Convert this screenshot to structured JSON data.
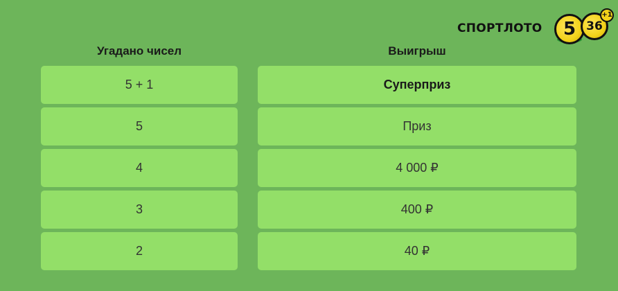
{
  "logo": {
    "text": "СПОРТЛОТО",
    "ball_5": "5",
    "ball_36": "36",
    "ball_plus": "+1"
  },
  "table": {
    "headers": {
      "guessed": "Угадано чисел",
      "win": "Выигрыш"
    },
    "rows": [
      {
        "guessed": "5 + 1",
        "win": "Суперприз",
        "emphasis": true
      },
      {
        "guessed": "5",
        "win": "Приз",
        "emphasis": false
      },
      {
        "guessed": "4",
        "win": "4 000 ₽",
        "emphasis": false
      },
      {
        "guessed": "3",
        "win": "400 ₽",
        "emphasis": false
      },
      {
        "guessed": "2",
        "win": "40 ₽",
        "emphasis": false
      }
    ]
  },
  "colors": {
    "background": "#6db55a",
    "cell": "#93df68",
    "ball": "#f2d21a"
  }
}
